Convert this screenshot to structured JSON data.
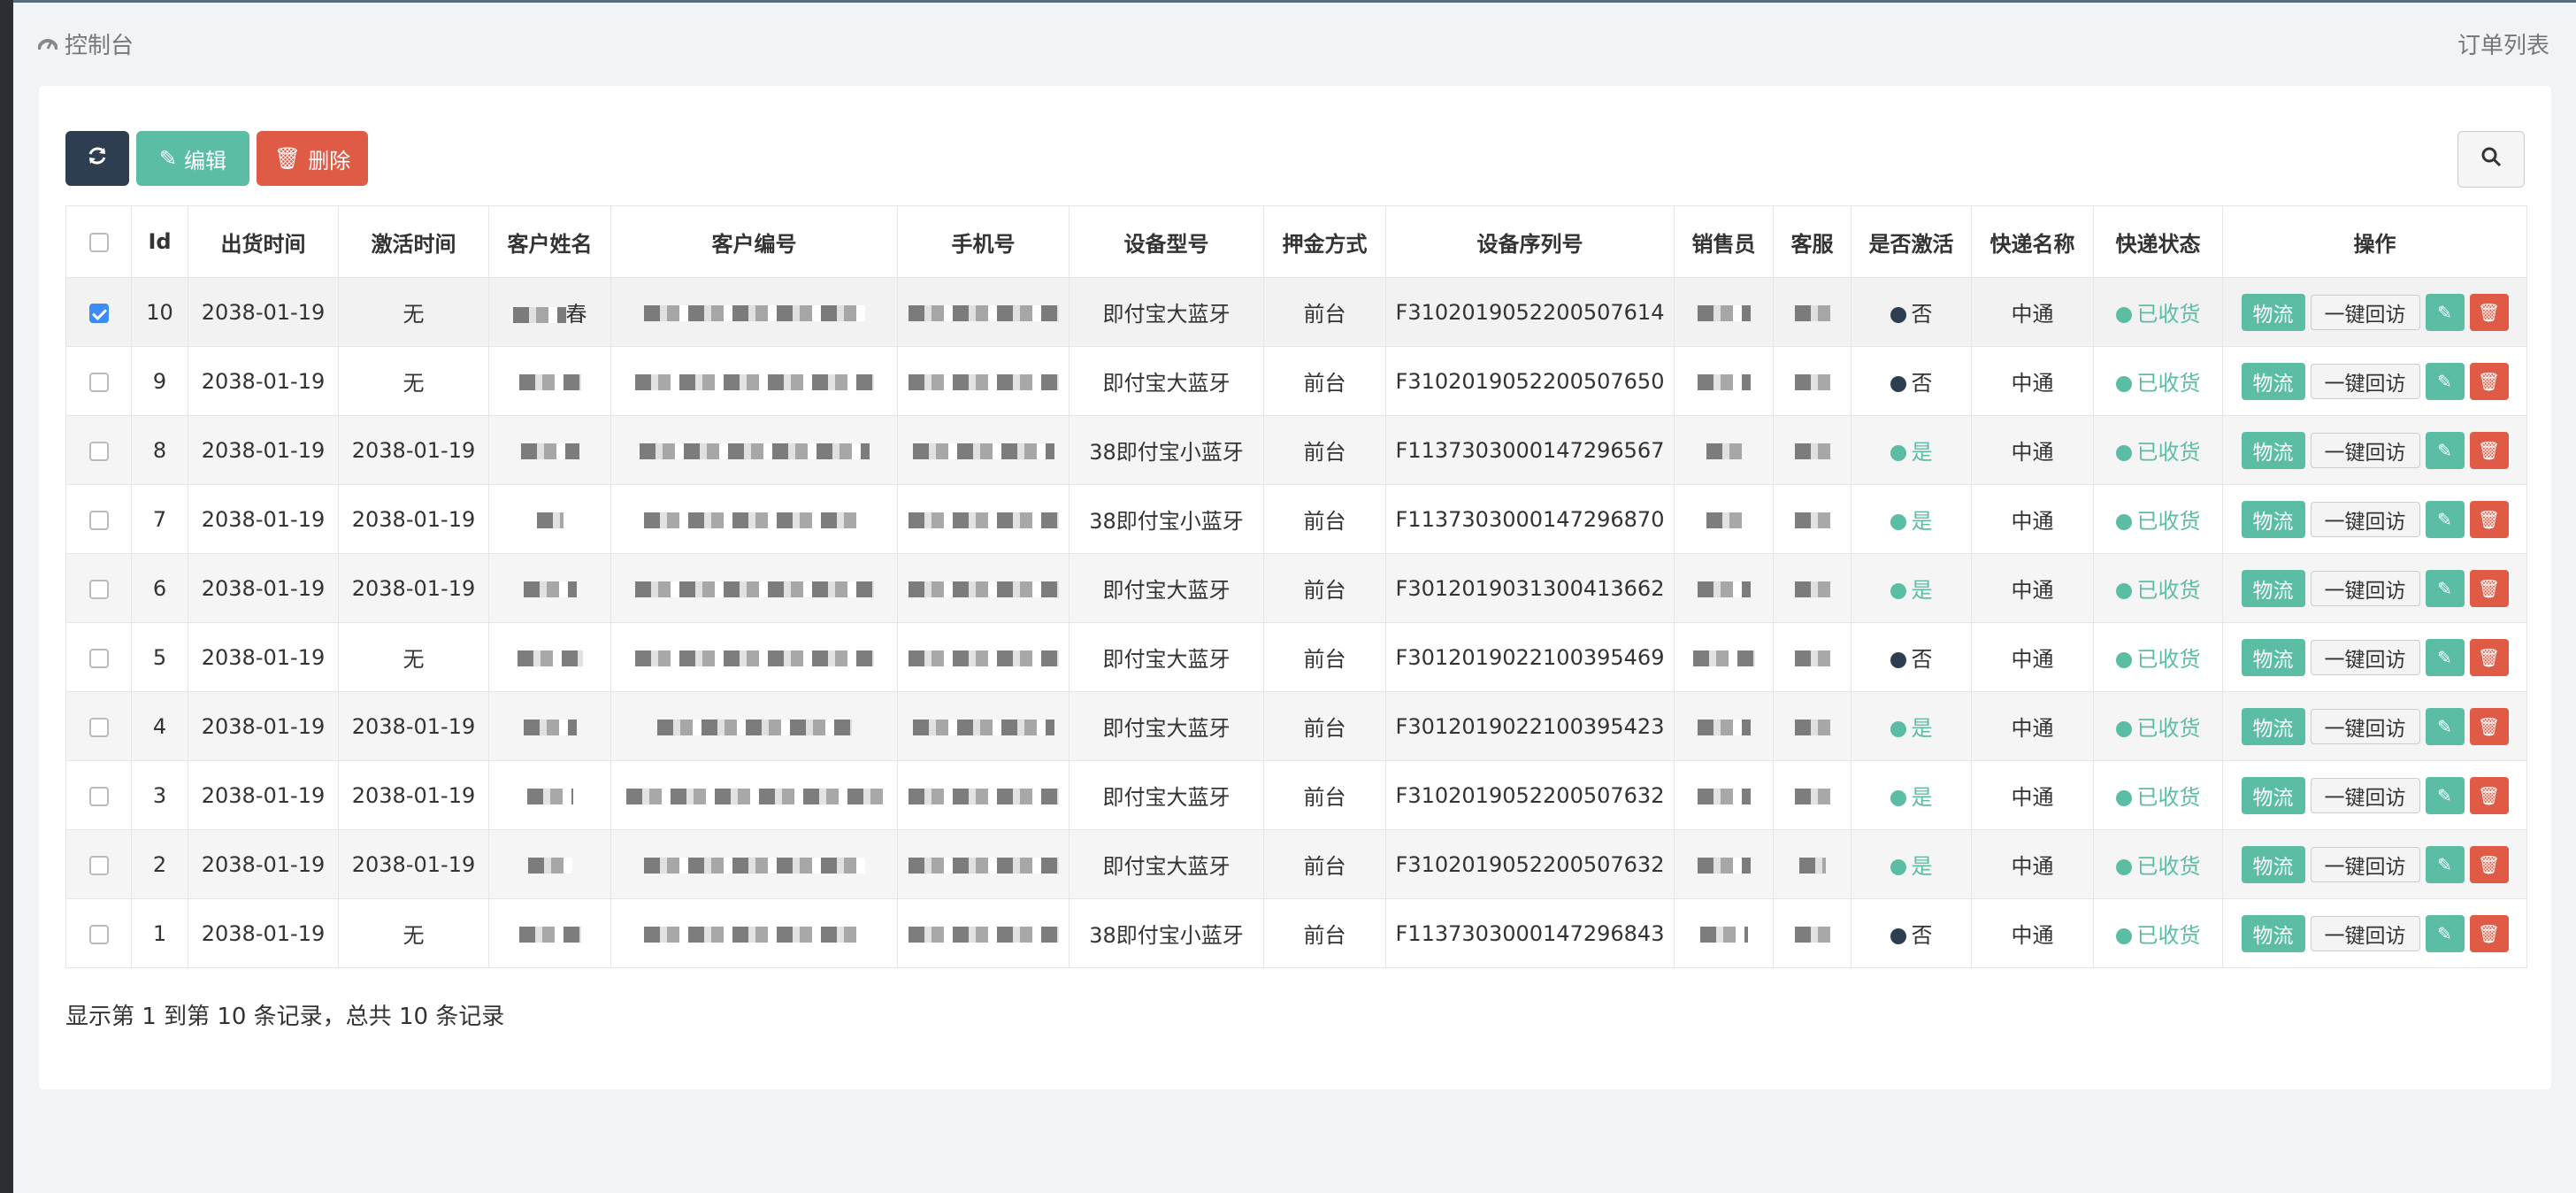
{
  "header": {
    "breadcrumb": "控制台",
    "page_title": "订单列表"
  },
  "toolbar": {
    "edit_label": "编辑",
    "delete_label": "删除"
  },
  "icons": {
    "dashboard": "dashboard-icon",
    "refresh": "refresh-icon",
    "pencil": "pencil-icon",
    "trash": "trash-icon",
    "search": "search-icon"
  },
  "table": {
    "columns": [
      "Id",
      "出货时间",
      "激活时间",
      "客户姓名",
      "客户编号",
      "手机号",
      "设备型号",
      "押金方式",
      "设备序列号",
      "销售员",
      "客服",
      "是否激活",
      "快递名称",
      "快递状态",
      "操作"
    ],
    "op_labels": {
      "logistics": "物流",
      "revisit": "一键回访"
    },
    "rows": [
      {
        "id": "10",
        "ship": "2038-01-19",
        "act": "无",
        "model": "即付宝大蓝牙",
        "deposit": "前台",
        "serial": "F3102019052200507614",
        "active": "否",
        "express": "中通",
        "status": "已收货",
        "checked": true,
        "name": "春"
      },
      {
        "id": "9",
        "ship": "2038-01-19",
        "act": "无",
        "model": "即付宝大蓝牙",
        "deposit": "前台",
        "serial": "F3102019052200507650",
        "active": "否",
        "express": "中通",
        "status": "已收货",
        "checked": false,
        "name": ""
      },
      {
        "id": "8",
        "ship": "2038-01-19",
        "act": "2038-01-19",
        "model": "38即付宝小蓝牙",
        "deposit": "前台",
        "serial": "F1137303000147296567",
        "active": "是",
        "express": "中通",
        "status": "已收货",
        "checked": false,
        "name": ""
      },
      {
        "id": "7",
        "ship": "2038-01-19",
        "act": "2038-01-19",
        "model": "38即付宝小蓝牙",
        "deposit": "前台",
        "serial": "F1137303000147296870",
        "active": "是",
        "express": "中通",
        "status": "已收货",
        "checked": false,
        "name": ""
      },
      {
        "id": "6",
        "ship": "2038-01-19",
        "act": "2038-01-19",
        "model": "即付宝大蓝牙",
        "deposit": "前台",
        "serial": "F3012019031300413662",
        "active": "是",
        "express": "中通",
        "status": "已收货",
        "checked": false,
        "name": ""
      },
      {
        "id": "5",
        "ship": "2038-01-19",
        "act": "无",
        "model": "即付宝大蓝牙",
        "deposit": "前台",
        "serial": "F3012019022100395469",
        "active": "否",
        "express": "中通",
        "status": "已收货",
        "checked": false,
        "name": ""
      },
      {
        "id": "4",
        "ship": "2038-01-19",
        "act": "2038-01-19",
        "model": "即付宝大蓝牙",
        "deposit": "前台",
        "serial": "F3012019022100395423",
        "active": "是",
        "express": "中通",
        "status": "已收货",
        "checked": false,
        "name": ""
      },
      {
        "id": "3",
        "ship": "2038-01-19",
        "act": "2038-01-19",
        "model": "即付宝大蓝牙",
        "deposit": "前台",
        "serial": "F3102019052200507632",
        "active": "是",
        "express": "中通",
        "status": "已收货",
        "checked": false,
        "name": ""
      },
      {
        "id": "2",
        "ship": "2038-01-19",
        "act": "2038-01-19",
        "model": "即付宝大蓝牙",
        "deposit": "前台",
        "serial": "F3102019052200507632",
        "active": "是",
        "express": "中通",
        "status": "已收货",
        "checked": false,
        "name": ""
      },
      {
        "id": "1",
        "ship": "2038-01-19",
        "act": "无",
        "model": "38即付宝小蓝牙",
        "deposit": "前台",
        "serial": "F1137303000147296843",
        "active": "否",
        "express": "中通",
        "status": "已收货",
        "checked": false,
        "name": ""
      }
    ]
  },
  "footer": {
    "pagination_text": "显示第 1 到第 10 条记录，总共 10 条记录"
  },
  "colors": {
    "primary_dark": "#2c3e50",
    "success": "#5cbda5",
    "danger": "#e05b46",
    "checkbox": "#3d8bf7"
  }
}
